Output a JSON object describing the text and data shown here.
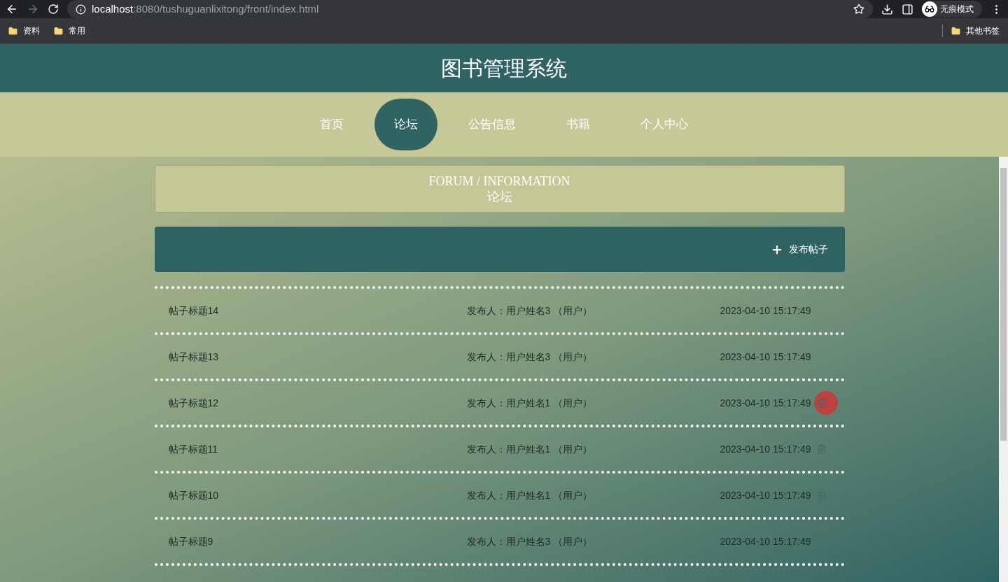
{
  "browser": {
    "url_host": "localhost",
    "url_path": ":8080/tushuguanlixitong/front/index.html",
    "profile": "无痕模式",
    "bookmarks": [
      "资料",
      "常用"
    ],
    "other_bookmarks": "其他书签"
  },
  "site_title": "图书管理系统",
  "nav": [
    {
      "label": "首页",
      "selected": false
    },
    {
      "label": "论坛",
      "selected": true
    },
    {
      "label": "公告信息",
      "selected": false
    },
    {
      "label": "书籍",
      "selected": false
    },
    {
      "label": "个人中心",
      "selected": false
    }
  ],
  "banner": {
    "title_en": "FORUM / INFORMATION",
    "title": "论坛"
  },
  "toolbar": {
    "add_label": "发布帖子"
  },
  "posts": [
    {
      "title": "帖子标题14",
      "author": "发布人：用户姓名3 （用户）",
      "time": "2023-04-10 15:17:49",
      "deletable": false,
      "hovered": false
    },
    {
      "title": "帖子标题13",
      "author": "发布人：用户姓名3 （用户）",
      "time": "2023-04-10 15:17:49",
      "deletable": false,
      "hovered": false
    },
    {
      "title": "帖子标题12",
      "author": "发布人：用户姓名1 （用户）",
      "time": "2023-04-10 15:17:49",
      "deletable": true,
      "hovered": true
    },
    {
      "title": "帖子标题11",
      "author": "发布人：用户姓名1 （用户）",
      "time": "2023-04-10 15:17:49",
      "deletable": true,
      "hovered": false
    },
    {
      "title": "帖子标题10",
      "author": "发布人：用户姓名1 （用户）",
      "time": "2023-04-10 15:17:49",
      "deletable": true,
      "hovered": false
    },
    {
      "title": "帖子标题9",
      "author": "发布人：用户姓名3 （用户）",
      "time": "2023-04-10 15:17:49",
      "deletable": false,
      "hovered": false
    }
  ]
}
